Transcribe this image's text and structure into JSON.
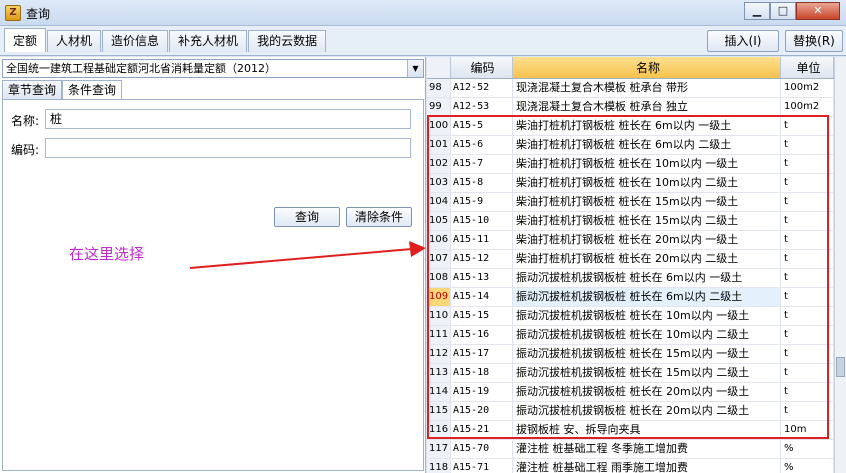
{
  "window": {
    "title": "查询",
    "icon_letter": "Z",
    "minimize": "▁",
    "maximize": "□",
    "close": "✕"
  },
  "tabs": [
    "定额",
    "人材机",
    "造价信息",
    "补充人材机",
    "我的云数据"
  ],
  "actions": {
    "insert": "插入(I)",
    "replace": "替换(R)"
  },
  "left": {
    "quota_set": "全国统一建筑工程基础定额河北省消耗量定额（2012）",
    "subtabs": [
      "章节查询",
      "条件查询"
    ],
    "name_label": "名称:",
    "name_value": "桩",
    "code_label": "编码:",
    "code_value": "",
    "query_button": "查询",
    "clear_button": "清除条件",
    "annotation": "在这里选择"
  },
  "grid": {
    "headers": {
      "code": "编码",
      "name": "名称",
      "unit": "单位"
    },
    "rows": [
      {
        "idx": "98",
        "code": "A12-52",
        "name": "现浇混凝土复合木模板 桩承台 带形",
        "unit": "100m2"
      },
      {
        "idx": "99",
        "code": "A12-53",
        "name": "现浇混凝土复合木模板 桩承台 独立",
        "unit": "100m2"
      },
      {
        "idx": "100",
        "code": "A15-5",
        "name": "柴油打桩机打钢板桩 桩长在 6m以内 一级土",
        "unit": "t"
      },
      {
        "idx": "101",
        "code": "A15-6",
        "name": "柴油打桩机打钢板桩 桩长在 6m以内 二级土",
        "unit": "t"
      },
      {
        "idx": "102",
        "code": "A15-7",
        "name": "柴油打桩机打钢板桩 桩长在 10m以内 一级土",
        "unit": "t"
      },
      {
        "idx": "103",
        "code": "A15-8",
        "name": "柴油打桩机打钢板桩 桩长在 10m以内 二级土",
        "unit": "t"
      },
      {
        "idx": "104",
        "code": "A15-9",
        "name": "柴油打桩机打钢板桩 桩长在 15m以内 一级土",
        "unit": "t"
      },
      {
        "idx": "105",
        "code": "A15-10",
        "name": "柴油打桩机打钢板桩 桩长在 15m以内 二级土",
        "unit": "t"
      },
      {
        "idx": "106",
        "code": "A15-11",
        "name": "柴油打桩机打钢板桩 桩长在 20m以内 一级土",
        "unit": "t"
      },
      {
        "idx": "107",
        "code": "A15-12",
        "name": "柴油打桩机打钢板桩 桩长在 20m以内 二级土",
        "unit": "t"
      },
      {
        "idx": "108",
        "code": "A15-13",
        "name": "振动沉拔桩机拔钢板桩 桩长在 6m以内 一级土",
        "unit": "t"
      },
      {
        "idx": "109",
        "code": "A15-14",
        "name": "振动沉拔桩机拔钢板桩 桩长在 6m以内 二级土",
        "unit": "t",
        "selected": true
      },
      {
        "idx": "110",
        "code": "A15-15",
        "name": "振动沉拔桩机拔钢板桩 桩长在 10m以内 一级土",
        "unit": "t"
      },
      {
        "idx": "111",
        "code": "A15-16",
        "name": "振动沉拔桩机拔钢板桩 桩长在 10m以内 二级土",
        "unit": "t"
      },
      {
        "idx": "112",
        "code": "A15-17",
        "name": "振动沉拔桩机拔钢板桩 桩长在 15m以内 一级土",
        "unit": "t"
      },
      {
        "idx": "113",
        "code": "A15-18",
        "name": "振动沉拔桩机拔钢板桩 桩长在 15m以内 二级土",
        "unit": "t"
      },
      {
        "idx": "114",
        "code": "A15-19",
        "name": "振动沉拔桩机拔钢板桩 桩长在 20m以内 一级土",
        "unit": "t"
      },
      {
        "idx": "115",
        "code": "A15-20",
        "name": "振动沉拔桩机拔钢板桩 桩长在 20m以内 二级土",
        "unit": "t"
      },
      {
        "idx": "116",
        "code": "A15-21",
        "name": "拔钢板桩 安、拆导向夹具",
        "unit": "10m"
      },
      {
        "idx": "117",
        "code": "A15-70",
        "name": "灌注桩 桩基础工程 冬季施工增加费",
        "unit": "%"
      },
      {
        "idx": "118",
        "code": "A15-71",
        "name": "灌注桩 桩基础工程 雨季施工增加费",
        "unit": "%"
      }
    ]
  },
  "colors": {
    "annotation": "#c02bd0",
    "highlight_box": "#e02020",
    "arrow": "#e02020"
  }
}
